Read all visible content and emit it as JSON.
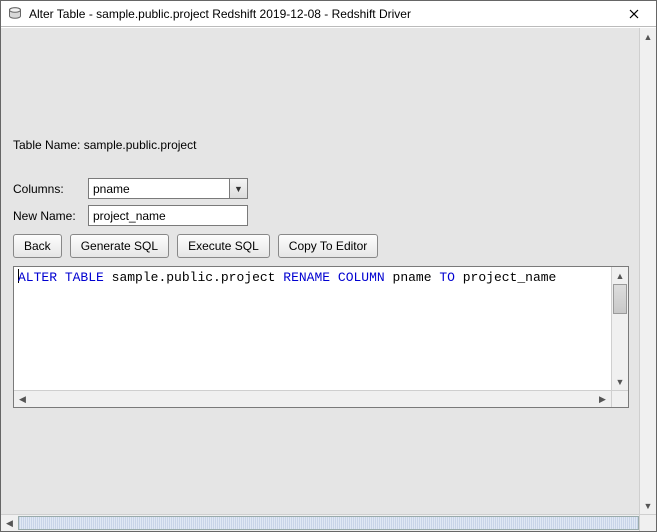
{
  "window": {
    "title": "Alter Table - sample.public.project Redshift 2019-12-08 - Redshift Driver"
  },
  "tableName": {
    "label": "Table Name:",
    "value": "sample.public.project"
  },
  "columns": {
    "label": "Columns:",
    "selected": "pname"
  },
  "newName": {
    "label": "New Name:",
    "value": "project_name"
  },
  "buttons": {
    "back": "Back",
    "generateSql": "Generate SQL",
    "executeSql": "Execute SQL",
    "copyToEditor": "Copy To Editor"
  },
  "sql": {
    "kw1": "ALTER",
    "kw2": "TABLE",
    "mid1": " sample.public.project ",
    "kw3": "RENAME",
    "kw4": "COLUMN",
    "mid2": " pname ",
    "kw5": "TO",
    "tail": " project_name"
  }
}
